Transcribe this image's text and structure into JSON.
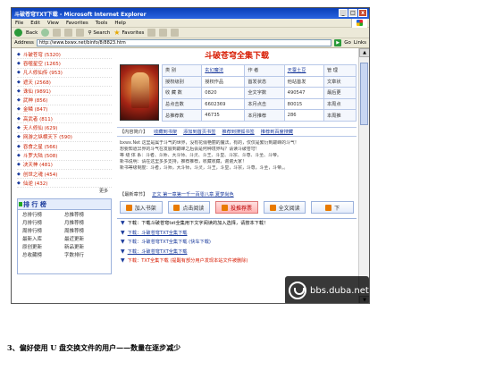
{
  "window": {
    "title": "斗破苍穹TXT下载 - Microsoft Internet Explorer",
    "buttons": [
      "_",
      "□",
      "x"
    ]
  },
  "menu": {
    "items": [
      "File",
      "Edit",
      "View",
      "Favorites",
      "Tools",
      "Help"
    ]
  },
  "toolbar": {
    "back_label": "Back",
    "search_label": "Search",
    "favorites_label": "Favorites"
  },
  "address": {
    "label": "Address",
    "url": "http://www.bxwx.net/binfo/8/8823.htm",
    "go_label": "Go",
    "links_label": "Links"
  },
  "sidebar": {
    "books": [
      "斗破苍穹 (5320)",
      "吞噬星空 (1265)",
      "凡人修仙传 (953)",
      "遮天 (2568)",
      "诛仙 (9891)",
      "武神 (856)",
      "金鳞 (847)",
      "高武者 (811)",
      "天人修仙 (629)",
      "网游之纵横天下 (590)",
      "吞食之星 (566)",
      "斗罗大陆 (508)",
      "决天神 (481)",
      "创世之魂 (454)",
      "仙逆 (432)"
    ],
    "more": "更多"
  },
  "ranking": {
    "title": "排 行 榜",
    "items": [
      "总排行榜",
      "总推荐榜",
      "月排行榜",
      "月推荐榜",
      "周排行榜",
      "周推荐榜",
      "最新入库",
      "最近更新",
      "原创更新",
      "新品更新",
      "总收藏榜",
      "字数排行"
    ]
  },
  "book": {
    "title": "斗破苍穹全集下载",
    "info": [
      [
        "类 别",
        "玄幻魔法",
        "作 者",
        "天蚕土豆",
        "管 理"
      ],
      [
        "授权级别",
        "授权作品",
        "首发状态",
        "他站首发",
        "文章状"
      ],
      [
        "收 藏 数",
        "0820",
        "全文字数",
        "490547",
        "最后更"
      ],
      [
        "总点击数",
        "6602369",
        "本月点击",
        "80015",
        "本周点"
      ],
      [
        "总推荐数",
        "46735",
        "本月推荐",
        "286",
        "本周推"
      ]
    ],
    "directory": {
      "label": "【内容简介】",
      "links": [
        "收藏到书架",
        "添加到首页书签",
        "推荐到搜狐书签",
        "推荐到百度搜藏"
      ]
    },
    "summary": [
      "bxwx.Net      这里是属于斗气的世界，没有花俏艳丽的魔法，有的，仅仅是繁衍到巅峰的斗气！",
      "     想要知道异界的斗气在发展到巅峰之后会是何种境界吗？请读斗破苍穹！",
      "等 级 体 系：斗者、斗师、大斗师、斗灵、斗王、斗皇、斗宗、斗尊、斗圣、斗帝。",
      "     新书说明：请在这里多多支持，推荐推荐，收藏收藏，谢谢大家！",
      "     新书等级制度：斗者，斗师，大斗师，斗灵，斗王，斗皇，斗宗，斗尊，斗圣，斗帝。。"
    ],
    "latest": {
      "label": "【最新章节】",
      "links": [
        "正文 第一章第一千一百零八章 夏梦尚色"
      ]
    },
    "actions": [
      "加入书架",
      "点击阅读",
      "投推荐票",
      "全文阅读",
      "下"
    ],
    "downloads": [
      "下载：下载斗破苍穹txt全集用下文字阅读的加入选择，请按本下载！",
      "下载：斗破苍穹TXT全集下载",
      "下载：斗破苍穹TXT全集下载 (快车下载)",
      "下载：斗破苍穹TXT全集下载",
      "下载：TXT全集下载  (提醒有部分用户发现本站文件被删除)"
    ]
  },
  "watermark": {
    "text": "bbs.duba.net"
  },
  "caption": {
    "text": "3、偏好使用 U 盘交换文件的用户——数量在逐步减少"
  }
}
